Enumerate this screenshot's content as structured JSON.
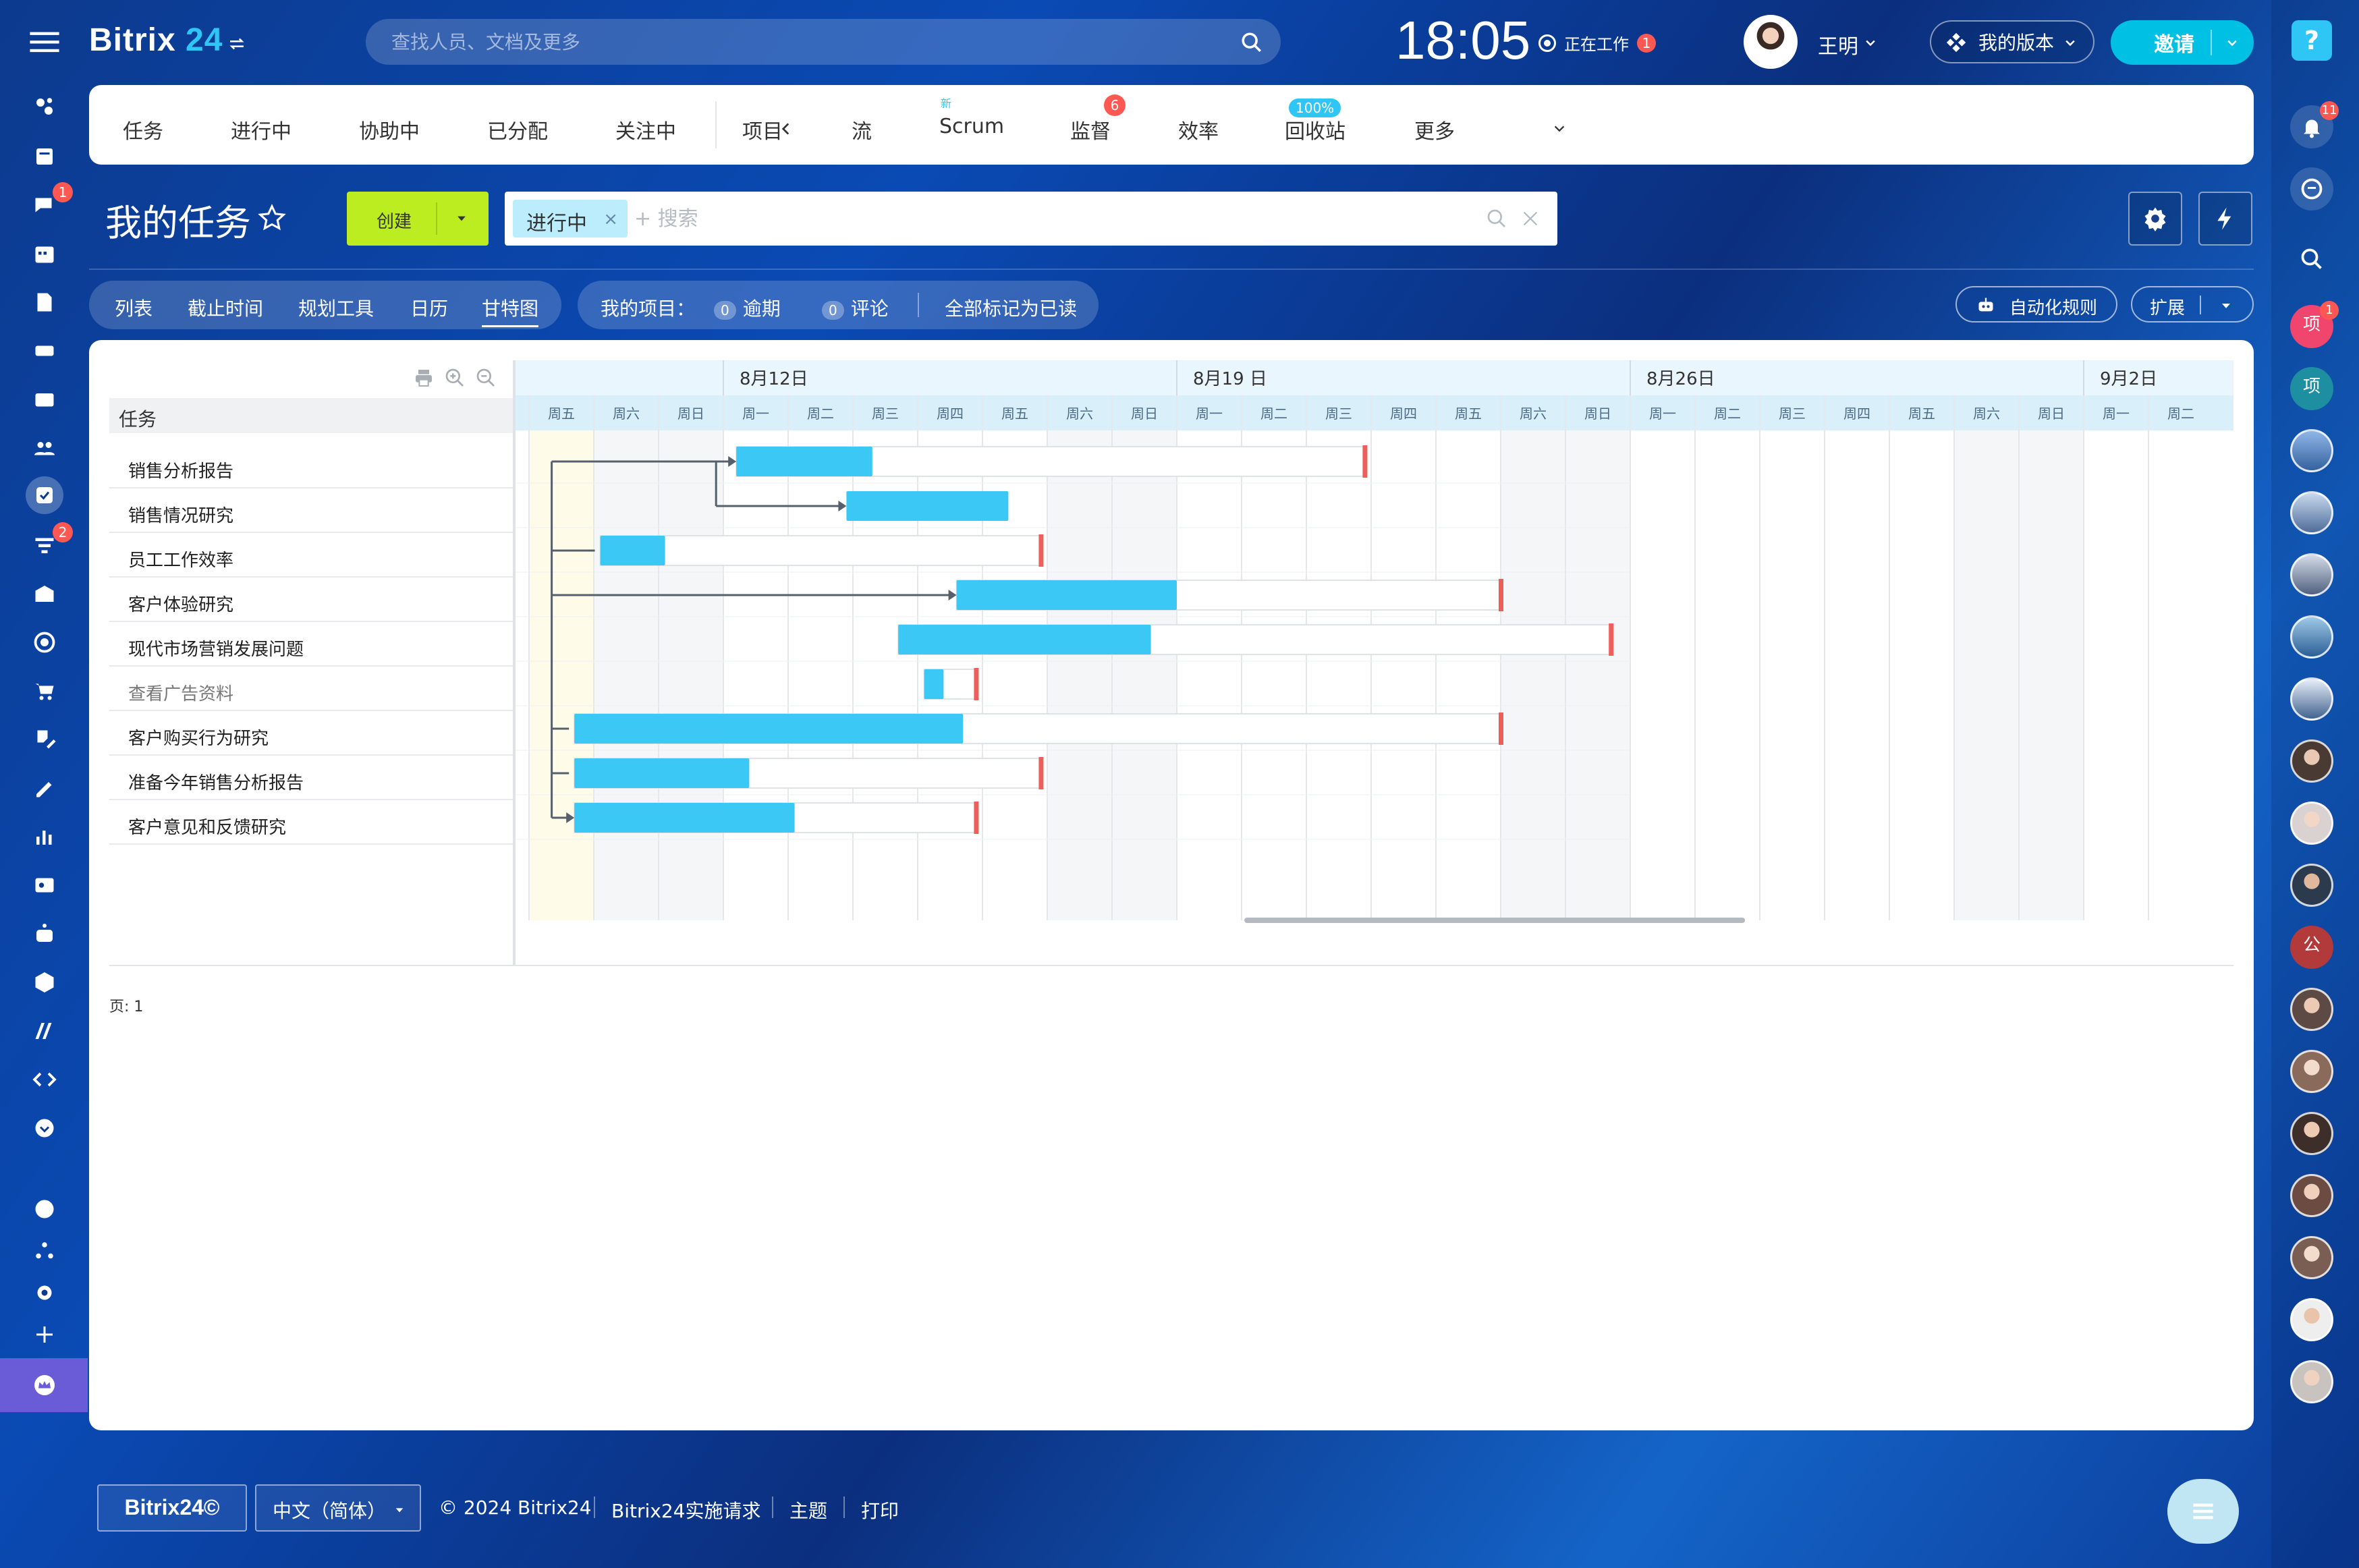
{
  "app": {
    "logo_main": "Bitrix",
    "logo_num": "24"
  },
  "header": {
    "search_placeholder": "查找人员、文档及更多",
    "time": "18:05",
    "work_status": "正在工作",
    "work_badge": "1",
    "user_name": "王明",
    "version_label": "我的版本",
    "invite_label": "邀请"
  },
  "left_sidebar": {
    "chat_badge": "1",
    "crm_badge": "2"
  },
  "right_sidebar": {
    "notify_badge": "11",
    "project_label_1": "项",
    "project_badge": "1",
    "project_label_2": "项",
    "contact_label": "公"
  },
  "nav": {
    "items": [
      "任务",
      "进行中",
      "协助中",
      "已分配",
      "关注中",
      "项目",
      "流",
      "Scrum",
      "监督",
      "效率",
      "回收站",
      "更多"
    ],
    "flow_new": "新",
    "supervise_badge": "6",
    "efficiency_pct": "100%"
  },
  "page": {
    "title": "我的任务",
    "create_label": "创建",
    "filter_chip": "进行中",
    "filter_placeholder": "+ 搜索"
  },
  "view_tabs": [
    "列表",
    "截止时间",
    "规划工具",
    "日历",
    "甘特图"
  ],
  "active_view": "甘特图",
  "my_items": {
    "label": "我的项目：",
    "overdue_count": "0",
    "overdue_label": "逾期",
    "comments_count": "0",
    "comments_label": "评论",
    "mark_read": "全部标记为已读"
  },
  "automation_label": "自动化规则",
  "extensions_label": "扩展",
  "gantt": {
    "task_header": "任务",
    "tasks": [
      {
        "name": "销售分析报告",
        "muted": false
      },
      {
        "name": "销售情况研究",
        "muted": false
      },
      {
        "name": "员工工作效率",
        "muted": false
      },
      {
        "name": "客户体验研究",
        "muted": false
      },
      {
        "name": "现代市场营销发展问题",
        "muted": false
      },
      {
        "name": "查看广告资料",
        "muted": true
      },
      {
        "name": "客户购买行为研究",
        "muted": false
      },
      {
        "name": "准备今年销售分析报告",
        "muted": false
      },
      {
        "name": "客户意见和反馈研究",
        "muted": false
      }
    ],
    "week_labels": [
      "8月12日",
      "8月19 日",
      "8月26日",
      "9月2日"
    ],
    "day_labels": [
      "周五",
      "周六",
      "周日",
      "周一",
      "周二",
      "周三",
      "周四",
      "周五",
      "周六",
      "周日",
      "周一",
      "周二",
      "周三",
      "周四",
      "周五",
      "周六",
      "周日",
      "周一",
      "周二",
      "周三",
      "周四",
      "周五",
      "周六",
      "周日",
      "周一",
      "周二"
    ],
    "bars_in_days": [
      {
        "start": 3.2,
        "end": 5.3,
        "deadline": 12.9
      },
      {
        "start": 4.9,
        "end": 7.4,
        "deadline": null
      },
      {
        "start": 1.1,
        "end": 2.1,
        "deadline": 7.9
      },
      {
        "start": 6.6,
        "end": 10.0,
        "deadline": 15.0
      },
      {
        "start": 5.7,
        "end": 9.6,
        "deadline": 16.7
      },
      {
        "start": 6.1,
        "end": 6.4,
        "deadline": 6.9
      },
      {
        "start": 0.7,
        "end": 6.7,
        "deadline": 15.0
      },
      {
        "start": 0.7,
        "end": 3.4,
        "deadline": 7.9
      },
      {
        "start": 0.7,
        "end": 4.1,
        "deadline": 6.9
      }
    ],
    "dependencies": [
      {
        "from": 0,
        "to": [
          0,
          3,
          8
        ]
      },
      {
        "from": 1,
        "to": [
          1
        ]
      }
    ],
    "page_label": "页: 1"
  },
  "footer": {
    "logo": "Bitrix24©",
    "language": "中文（简体）",
    "copyright": "© 2024 Bitrix24",
    "links": [
      "Bitrix24实施请求",
      "主题",
      "打印"
    ]
  },
  "colors": {
    "accent": "#2fc6f6",
    "bar": "#3bc8f5",
    "deadline": "#ee5f5b",
    "create": "#bbed21",
    "today_col": "#fffbe9"
  },
  "icons": [
    "menu-icon",
    "search-icon",
    "star-icon",
    "settings-icon",
    "lightning-icon",
    "bell-icon",
    "chat-icon",
    "robot-icon",
    "print-icon",
    "zoom-in-icon",
    "zoom-out-icon"
  ]
}
